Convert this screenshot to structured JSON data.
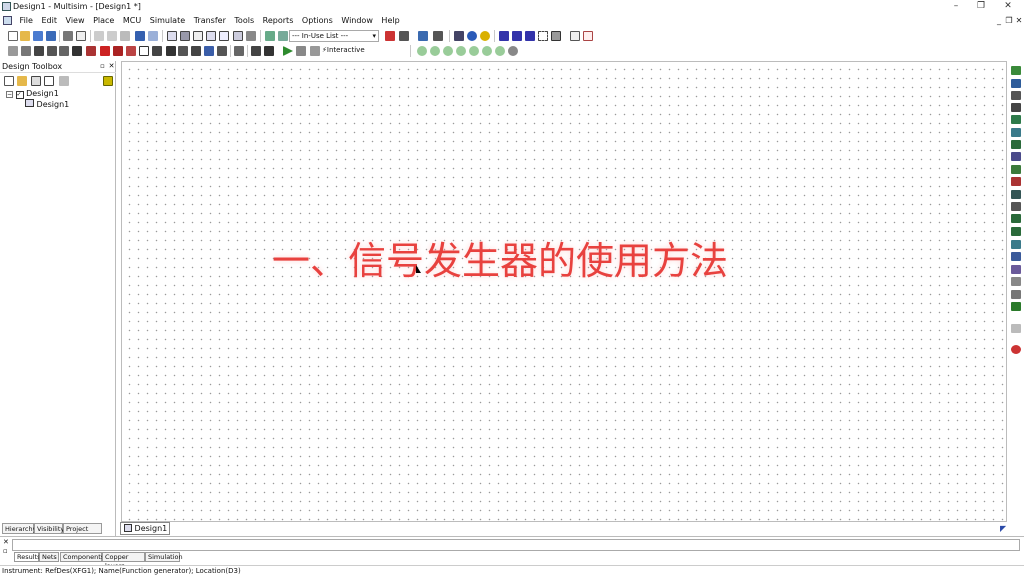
{
  "window": {
    "title": "Design1 - Multisim - [Design1 *]"
  },
  "menu": [
    "File",
    "Edit",
    "View",
    "Place",
    "MCU",
    "Simulate",
    "Transfer",
    "Tools",
    "Reports",
    "Options",
    "Window",
    "Help"
  ],
  "toolbar": {
    "inuse_list": "--- In-Use List ---",
    "interactive": "Interactive"
  },
  "toolbox": {
    "title": "Design Toolbox",
    "tree_root": "Design1",
    "tree_child": "Design1",
    "tabs": [
      "Hierarchy",
      "Visibility",
      "Project View"
    ]
  },
  "overlay_text": "一、信号发生器的使用方法",
  "document_tab": "Design1 *",
  "spreadsheet_tabs": [
    "Results",
    "Nets",
    "Components",
    "Copper layers",
    "Simulation"
  ],
  "status_text": "Instrument: RefDes(XFG1); Name(Function generator); Location(D3)",
  "colors": {
    "overlay": "#e8413e",
    "accent_green": "#2e8b2e",
    "grid_dot": "#9a9a9a"
  }
}
